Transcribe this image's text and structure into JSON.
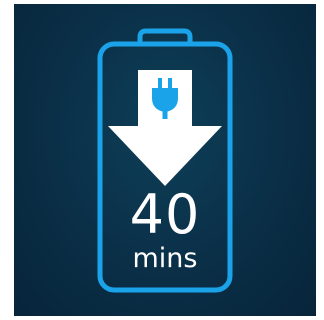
{
  "charge": {
    "value": "40",
    "unit": "mins"
  },
  "icons": {
    "battery": "battery-outline-icon",
    "arrow": "arrow-down-icon",
    "plug": "power-plug-icon"
  },
  "colors": {
    "background": "#0a2f47",
    "accent": "#1aa3e8",
    "foreground": "#ffffff"
  }
}
